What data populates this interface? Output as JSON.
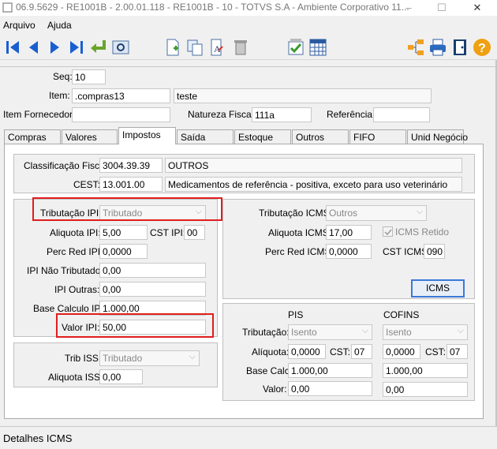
{
  "window": {
    "title": "06.9.5629 - RE1001B - 2.00.01.118 - RE1001B - 10 - TOTVS S.A - Ambiente Corporativo 11...",
    "minimize": "–",
    "maximize": "☐",
    "close": "✕"
  },
  "menu": {
    "arquivo": "Arquivo",
    "ajuda": "Ajuda"
  },
  "header": {
    "seq_label": "Seq:",
    "seq_value": "10",
    "item_label": "Item:",
    "item_value": ".compras13",
    "item_desc": "teste",
    "fornecedor_label": "Item Fornecedor:",
    "fornecedor_value": "",
    "natureza_label": "Natureza Fiscal:",
    "natureza_value": "111a",
    "referencia_label": "Referência:",
    "referencia_value": ""
  },
  "tabs": [
    "Compras",
    "Valores",
    "Impostos",
    "Saída",
    "Estoque",
    "Outros",
    "FIFO",
    "Unid Negócio"
  ],
  "impostos": {
    "class_fiscal_label": "Classificação Fiscal:",
    "class_fiscal_value": "3004.39.39",
    "class_fiscal_desc": "OUTROS",
    "cest_label": "CEST:",
    "cest_value": "13.001.00",
    "cest_desc": "Medicamentos de referência - positiva, exceto para uso veterinário",
    "ipi": {
      "trib_label": "Tributação IPI:",
      "trib_value": "Tributado",
      "aliq_label": "Aliquota IPI:",
      "aliq_value": "5,00",
      "cst_label": "CST IPI:",
      "cst_value": "00",
      "perc_label": "Perc Red IPI:",
      "perc_value": "0,0000",
      "nao_trib_label": "IPI Não Tributado:",
      "nao_trib_value": "0,00",
      "outras_label": "IPI Outras:",
      "outras_value": "0,00",
      "base_label": "Base Calculo IPI:",
      "base_value": "1.000,00",
      "valor_label": "Valor IPI:",
      "valor_value": "50,00"
    },
    "iss": {
      "trib_label": "Trib ISS:",
      "trib_value": "Tributado",
      "aliq_label": "Aliquota ISS:",
      "aliq_value": "0,00"
    },
    "icms": {
      "trib_label": "Tributação ICMS:",
      "trib_value": "Outros",
      "aliq_label": "Aliquota ICMS:",
      "aliq_value": "17,00",
      "retido_label": "ICMS Retido",
      "perc_label": "Perc Red ICMS:",
      "perc_value": "0,0000",
      "cst_label": "CST ICMS:",
      "cst_value": "090",
      "button": "ICMS"
    },
    "pis_cofins": {
      "pis_header": "PIS",
      "cofins_header": "COFINS",
      "trib_label": "Tributação:",
      "aliq_label": "Alíquota:",
      "base_label": "Base Calc:",
      "valor_label": "Valor:",
      "cst_label": "CST:",
      "pis": {
        "trib": "Isento",
        "aliq": "0,0000",
        "cst": "07",
        "base": "1.000,00",
        "valor": "0,00"
      },
      "cofins": {
        "trib": "Isento",
        "aliq": "0,0000",
        "cst": "07",
        "base": "1.000,00",
        "valor": "0,00"
      }
    }
  },
  "status": {
    "text": "Detalhes ICMS"
  },
  "colors": {
    "highlight": "#e01e1e",
    "accent": "#3b79d8"
  }
}
